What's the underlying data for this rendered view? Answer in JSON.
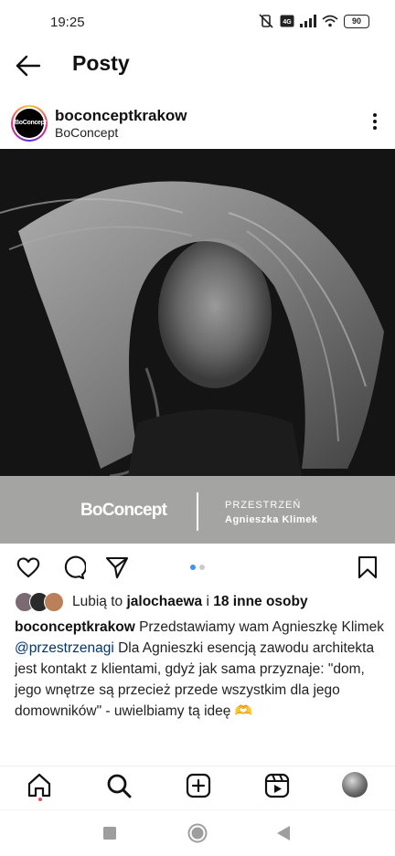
{
  "status_bar": {
    "time": "19:25",
    "battery": "90"
  },
  "header": {
    "title": "Posty"
  },
  "post": {
    "username": "boconceptkrakow",
    "subtitle": "BoConcept",
    "avatar_text": "BoConcept",
    "banner": {
      "logo": "BoConcept",
      "line1": "PRZESTRZEŃ",
      "line2": "Agnieszka Klimek"
    },
    "carousel": {
      "current": 1,
      "total": 2
    },
    "likes": {
      "prefix": "Lubią to ",
      "user": "jalochaewa",
      "middle": " i ",
      "others": "18 inne osoby"
    },
    "caption": {
      "author": "boconceptkrakow",
      "text1": " Przedstawiamy wam Agnieszkę Klimek ",
      "mention": "@przestrzenagi",
      "text2": " Dla Agnieszki esencją zawodu architekta jest kontakt z klientami, gdyż jak sama przyznaje: \"dom, jego wnętrze są przecież przede wszystkim dla jego domowników\" - uwielbiamy tą ideę 🫶"
    }
  },
  "icons": {
    "back": "arrow-left-icon",
    "more": "more-vertical-icon",
    "like": "heart-icon",
    "comment": "comment-icon",
    "share": "send-icon",
    "save": "bookmark-icon",
    "nav": [
      "home-icon",
      "search-icon",
      "create-icon",
      "reels-icon",
      "profile-avatar"
    ]
  },
  "colors": {
    "mention": "#00376b",
    "carousel_active": "#3897f0",
    "notification_dot": "#ed4956"
  }
}
